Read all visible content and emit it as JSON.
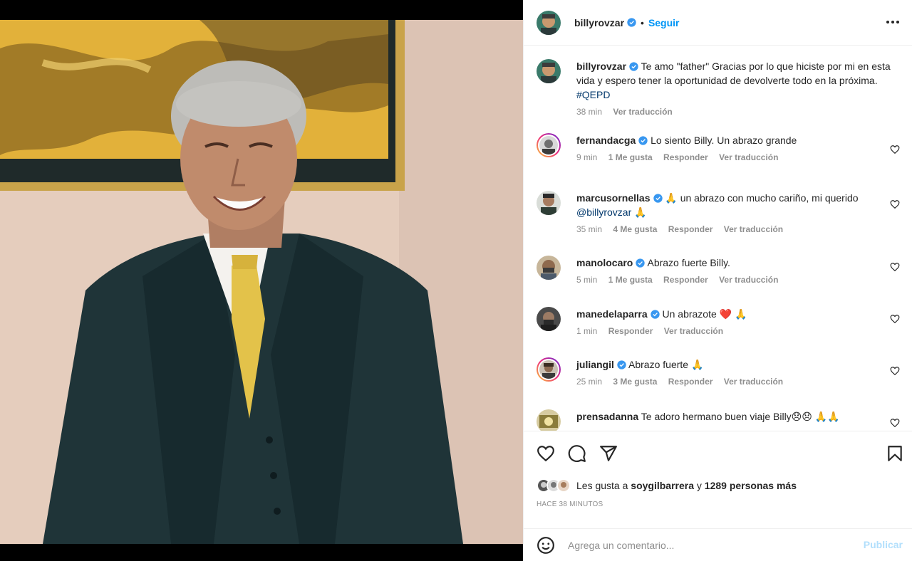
{
  "post": {
    "author": "billyrovzar",
    "follow_label": "Seguir",
    "dot": "•",
    "caption": {
      "username": "billyrovzar",
      "text": "Te amo \"father\" Gracias por lo que hiciste por mi en esta vida y espero tener la oportunidad de devolverte todo en la próxima.",
      "hashtag": "#QEPD",
      "time": "38 min",
      "translate": "Ver traducción"
    }
  },
  "comments": [
    {
      "username": "fernandacga",
      "text": "Lo siento Billy. Un abrazo grande",
      "time": "9 min",
      "likes": "1 Me gusta",
      "reply": "Responder",
      "translate": "Ver traducción"
    },
    {
      "username": "marcusornellas",
      "text": "🙏 un abrazo con mucho cariño, mi querido",
      "mention": "@billyrovzar",
      "text2": "🙏",
      "time": "35 min",
      "likes": "4 Me gusta",
      "reply": "Responder",
      "translate": "Ver traducción"
    },
    {
      "username": "manolocaro",
      "text": "Abrazo fuerte Billy.",
      "time": "5 min",
      "likes": "1 Me gusta",
      "reply": "Responder",
      "translate": "Ver traducción"
    },
    {
      "username": "manedelaparra",
      "text": "Un abrazote ❤️ 🙏",
      "time": "1 min",
      "reply": "Responder",
      "translate": "Ver traducción"
    },
    {
      "username": "juliangil",
      "text": "Abrazo fuerte 🙏",
      "time": "25 min",
      "likes": "3 Me gusta",
      "reply": "Responder",
      "translate": "Ver traducción"
    },
    {
      "username": "prensadanna",
      "text": "Te adoro hermano buen viaje Billy😞😞 🙏🙏"
    }
  ],
  "likes_line": {
    "prefix": "Les gusta a",
    "user": "soygilbarrera",
    "middle": "y",
    "rest": "1289 personas más"
  },
  "timestamp": "HACE 38 MINUTOS",
  "composer": {
    "placeholder": "Agrega un comentario...",
    "publish": "Publicar"
  },
  "colors": {
    "link": "#0095f6",
    "publish_disabled": "#b2dffc",
    "verified": "#3897f0",
    "meta": "#8e8e8e"
  },
  "icons": [
    "verified-badge-icon",
    "more-options-icon",
    "heart-icon",
    "comment-icon",
    "share-icon",
    "bookmark-icon",
    "emoji-icon"
  ]
}
